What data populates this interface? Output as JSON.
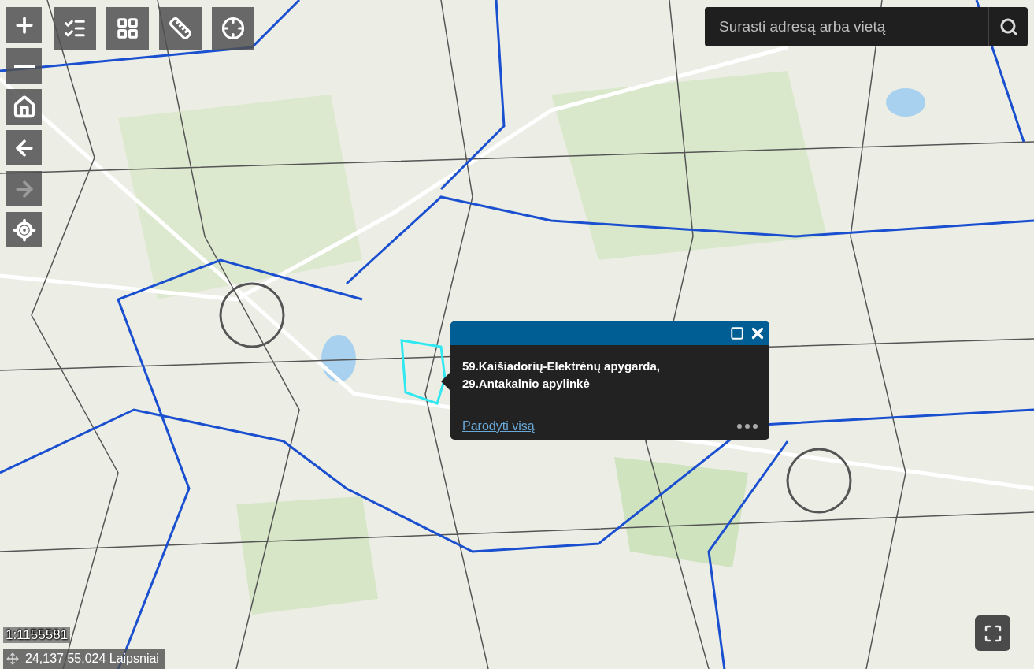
{
  "nav_buttons": [
    {
      "kind": "zoom-in",
      "disabled": false
    },
    {
      "kind": "zoom-out",
      "disabled": false
    },
    {
      "kind": "home",
      "disabled": false
    },
    {
      "kind": "back",
      "disabled": false
    },
    {
      "kind": "forward",
      "disabled": true
    },
    {
      "kind": "locate",
      "disabled": false
    }
  ],
  "tool_buttons": [
    {
      "kind": "layers"
    },
    {
      "kind": "basemap"
    },
    {
      "kind": "measure"
    },
    {
      "kind": "coordinate"
    }
  ],
  "search": {
    "placeholder": "Surasti adresą arba vietą"
  },
  "popup": {
    "lines": [
      "59.Kaišiadorių-Elektrėnų apygarda,",
      "29.Antakalnio apylinkė"
    ],
    "link": "Parodyti visą"
  },
  "scale": "1:1155581",
  "coordinates": "24,137 55,024 Laipsniai"
}
